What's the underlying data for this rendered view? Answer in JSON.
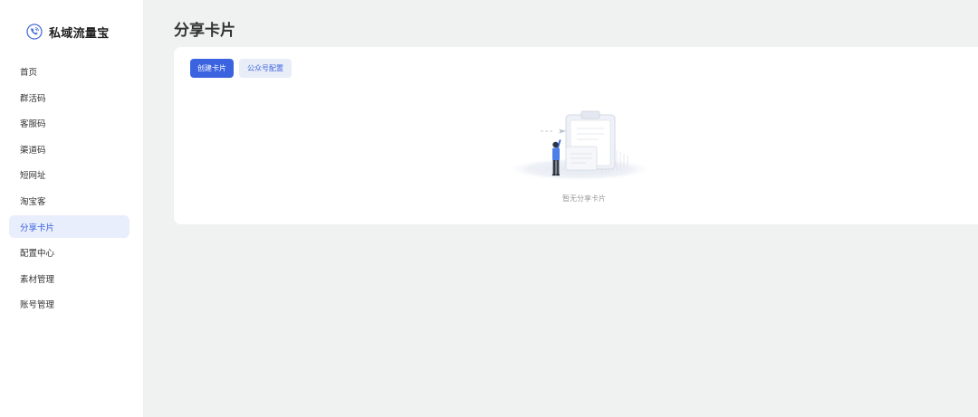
{
  "app": {
    "name": "私域流量宝",
    "logo_icon": "phone-icon"
  },
  "sidebar": {
    "items": [
      {
        "label": "首页",
        "active": false
      },
      {
        "label": "群活码",
        "active": false
      },
      {
        "label": "客服码",
        "active": false
      },
      {
        "label": "渠道码",
        "active": false
      },
      {
        "label": "短网址",
        "active": false
      },
      {
        "label": "淘宝客",
        "active": false
      },
      {
        "label": "分享卡片",
        "active": true
      },
      {
        "label": "配置中心",
        "active": false
      },
      {
        "label": "素材管理",
        "active": false
      },
      {
        "label": "账号管理",
        "active": false
      }
    ]
  },
  "page": {
    "title": "分享卡片"
  },
  "toolbar": {
    "create_label": "创建卡片",
    "config_label": "公众号配置"
  },
  "empty_state": {
    "text": "暂无分享卡片",
    "icon": "empty-clipboard-illustration"
  },
  "colors": {
    "accent": "#3b63e0",
    "active_bg": "#e9eefc",
    "secondary_btn_bg": "#e9edf8",
    "page_bg": "#f0f1f1",
    "card_bg": "#ffffff",
    "muted_text": "#9a9a9a"
  }
}
